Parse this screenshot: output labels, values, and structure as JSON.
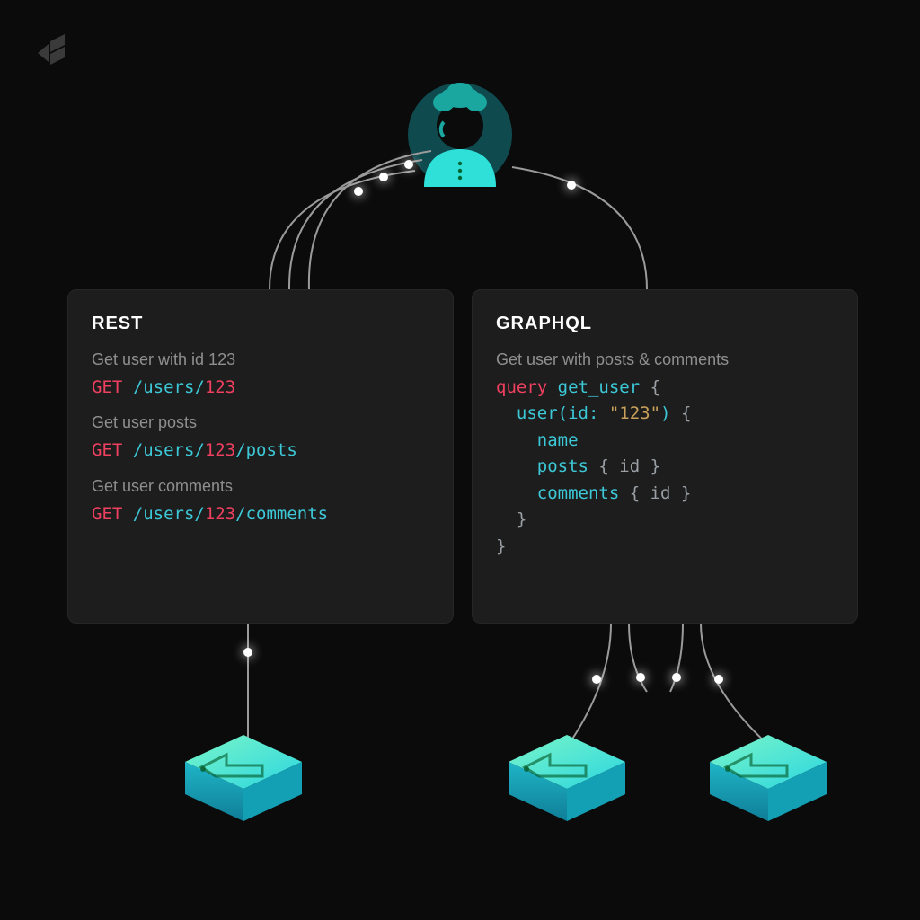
{
  "rest": {
    "title": "REST",
    "items": [
      {
        "desc": "Get user with id 123",
        "verb": "GET",
        "path_pre": " /users/",
        "id": "123",
        "path_post": ""
      },
      {
        "desc": "Get user posts",
        "verb": "GET",
        "path_pre": " /users/",
        "id": "123",
        "path_post": "/posts"
      },
      {
        "desc": "Get user comments",
        "verb": "GET",
        "path_pre": " /users/",
        "id": "123",
        "path_post": "/comments"
      }
    ]
  },
  "graphql": {
    "title": "GRAPHQL",
    "desc": "Get user with posts & comments",
    "code": {
      "kw_query": "query",
      "fn": "get_user",
      "open": "{",
      "user_call_pre": "  user(id: ",
      "user_id": "\"123\"",
      "user_call_post": ") ",
      "user_open": "{",
      "field_name": "    name",
      "field_posts": "    posts ",
      "posts_block": "{ id }",
      "field_comments": "    comments ",
      "comments_block": "{ id }",
      "close_inner": "  }",
      "close_outer": "}"
    }
  },
  "icons": {
    "logo": "bytebytego-logo",
    "avatar": "user-avatar",
    "cube": "server-cube"
  }
}
